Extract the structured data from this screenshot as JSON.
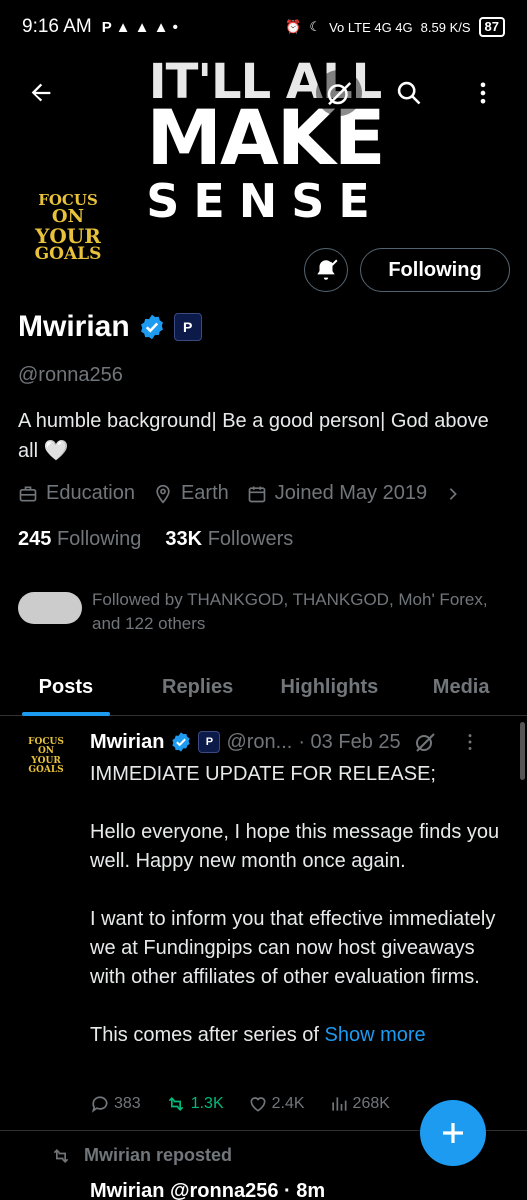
{
  "status_bar": {
    "time": "9:16 AM",
    "left_icons": "P ▲ ▲ ▲ •",
    "network": "Vo LTE 4G 4G",
    "speed": "8.59 K/S",
    "battery": "87"
  },
  "banner": {
    "line1": "IT'LL ALL",
    "line2": "MAKE",
    "line3": "SENSE"
  },
  "avatar_text": [
    "FOCUS",
    "ON",
    "YOUR",
    "GOALS"
  ],
  "profile": {
    "name": "Mwirian",
    "affiliate_badge": "P",
    "handle": "@ronna256",
    "bio": "A humble background| Be a good person| God above all 🤍",
    "category": "Education",
    "location": "Earth",
    "joined": "Joined May 2019",
    "following_count": "245",
    "following_label": "Following",
    "followers_count": "33K",
    "followers_label": "Followers",
    "followed_by": "Followed by THANKGOD, THANKGOD, Moh' Forex, and 122 others",
    "follow_button": "Following"
  },
  "tabs": [
    {
      "label": "Posts",
      "active": true
    },
    {
      "label": "Replies"
    },
    {
      "label": "Highlights"
    },
    {
      "label": "Media"
    }
  ],
  "post": {
    "name": "Mwirian",
    "handle": "@ron...",
    "date": "· 03 Feb 25",
    "paragraphs": [
      "IMMEDIATE UPDATE FOR RELEASE;",
      "Hello everyone, I hope this message finds you well. Happy new month once again.",
      "I want to inform you that effective immediately we at Fundingpips can now host giveaways with other affiliates of other evaluation firms."
    ],
    "last_line": "This comes after series of ",
    "show_more": "Show more",
    "replies": "383",
    "reposts": "1.3K",
    "likes": "2.4K",
    "views": "268K"
  },
  "repost": {
    "label": "Mwirian reposted",
    "next_preview": "Mwirian  @ronna256 · 8m"
  },
  "colors": {
    "accent": "#1d9bf0",
    "verified": "#1d9bf0",
    "repost_green": "#00ba7c",
    "muted": "#71767b"
  }
}
